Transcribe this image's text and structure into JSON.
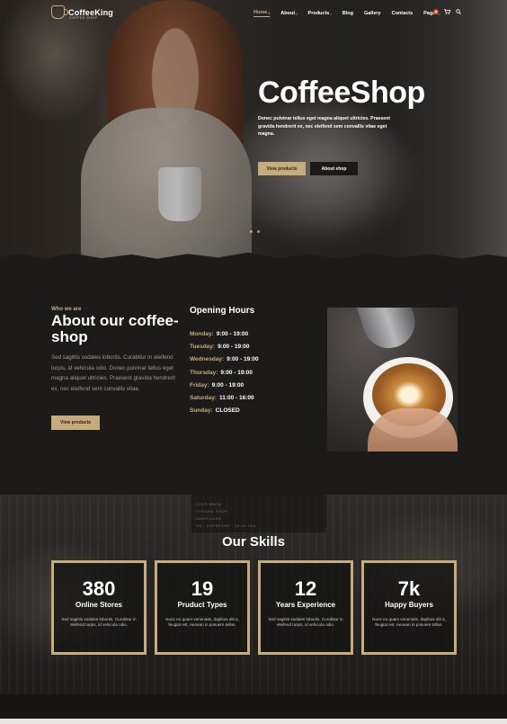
{
  "nav": {
    "logo_text": "CoffeeKing",
    "logo_tagline": "COFFEE SHOP",
    "items": [
      {
        "label": "Home",
        "caret": "▾",
        "active": true
      },
      {
        "label": "About",
        "caret": "›",
        "active": false
      },
      {
        "label": "Products",
        "caret": "›",
        "active": false
      },
      {
        "label": "Blog",
        "caret": "",
        "active": false
      },
      {
        "label": "Gallery",
        "caret": "",
        "active": false
      },
      {
        "label": "Contacts",
        "caret": "",
        "active": false
      },
      {
        "label": "Pages",
        "caret": "›",
        "active": false
      }
    ],
    "icons": [
      "flag-icon",
      "cart-icon",
      "search-icon"
    ]
  },
  "hero": {
    "title": "CoffeeShop",
    "text": "Donec pulvinar tellus eget magna aliquet ultricies. Praesent gravida hendrerit ex, nec eleifend sem convallis vitae eget magna.",
    "primary_button": "View products",
    "secondary_button": "About shop"
  },
  "about": {
    "eyebrow": "Who we are",
    "title": "About our coffee-shop",
    "text": "Sed sagittis sodales lobortis. Curabitur in eleifend turpis, id vehicula odio. Donec pulvinar tellus eget magna aliquet ultricies. Praesent gravida hendrerit ex, nec eleifend sem convallis vitae.",
    "button": "View products",
    "hours_title": "Opening Hours",
    "hours": [
      {
        "day": "Monday:",
        "time": "9:00 - 19:00"
      },
      {
        "day": "Tuesday:",
        "time": "9:00 - 19:00"
      },
      {
        "day": "Wednesday:",
        "time": "9:00 - 19:00"
      },
      {
        "day": "Thursday:",
        "time": "9:00 - 19:00"
      },
      {
        "day": "Friday:",
        "time": "9:00 - 19:00"
      },
      {
        "day": "Saturday:",
        "time": "11:00 - 16:00"
      },
      {
        "day": "Sunday:",
        "time": "CLOSED"
      }
    ]
  },
  "skills": {
    "title": "Our Skills",
    "board_lines": [
      "COLD BREW",
      "STRONG SHOP",
      "AMERICANO",
      "2/2 · ESPRESSO · 15-44 TEA"
    ],
    "cards": [
      {
        "number": "380",
        "label": "Online Stores",
        "desc": "Sed sagittis sodales lobortis. Curabitur in eleifend turpis, id vehicula odio."
      },
      {
        "number": "19",
        "label": "Pruduct Types",
        "desc": "Nunc eu quam venenatis, dapibus elit a, feugiat est. Aenean in posuere tellus."
      },
      {
        "number": "12",
        "label": "Years Experience",
        "desc": "Sed sagittis sodales lobortis. Curabitur in eleifend turpis, id vehicula odio."
      },
      {
        "number": "7k",
        "label": "Happy Buyers",
        "desc": "Nunc eu quam venenatis, dapibus elit a, feugiat est. Aenean in posuere tellus."
      }
    ]
  },
  "colors": {
    "accent": "#c6ac7a",
    "background": "#1c1b1a"
  }
}
